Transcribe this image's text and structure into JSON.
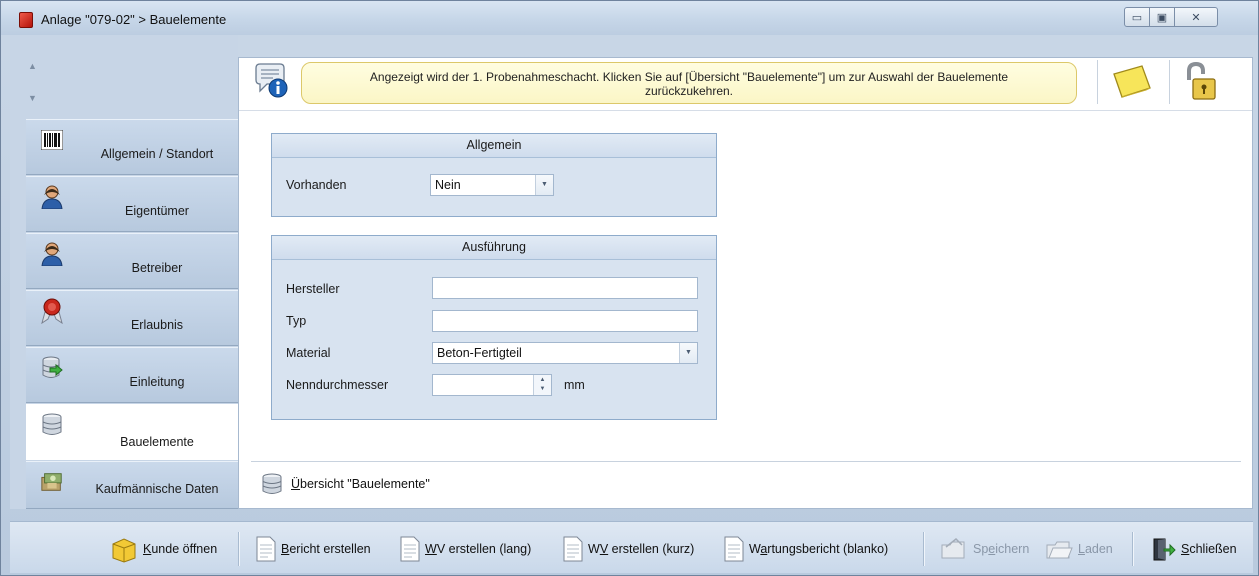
{
  "window": {
    "title": "Anlage \"079-02\" > Bauelemente",
    "controls": {
      "minimize": "▭",
      "maximize": "▣",
      "close": "✕"
    }
  },
  "nav": {
    "items": [
      {
        "label": "Allgemein / Standort",
        "icon": "barcode-icon",
        "active": false
      },
      {
        "label": "Eigentümer",
        "icon": "user-icon",
        "active": false
      },
      {
        "label": "Betreiber",
        "icon": "user-icon",
        "active": false
      },
      {
        "label": "Erlaubnis",
        "icon": "certificate-icon",
        "active": false
      },
      {
        "label": "Einleitung",
        "icon": "database-arrow-icon",
        "active": false
      },
      {
        "label": "Bauelemente",
        "icon": "database-icon",
        "active": true
      },
      {
        "label": "Kaufmännische Daten",
        "icon": "money-icon",
        "active": false
      }
    ]
  },
  "info": {
    "line1": "Angezeigt wird der 1. Probenahmeschacht. Klicken Sie auf [Übersicht \"Bauelemente\"] um zur Auswahl der Bauelemente",
    "line2": "zurückzukehren."
  },
  "groups": {
    "allgemein": {
      "title": "Allgemein",
      "vorhanden_label": "Vorhanden",
      "vorhanden_value": "Nein"
    },
    "ausfuehrung": {
      "title": "Ausführung",
      "hersteller_label": "Hersteller",
      "hersteller_value": "",
      "typ_label": "Typ",
      "typ_value": "",
      "material_label": "Material",
      "material_value": "Beton-Fertigteil",
      "nenndurchmesser_label": "Nenndurchmesser",
      "nenndurchmesser_value": "",
      "unit": "mm"
    }
  },
  "overview_link": {
    "underlined": "Ü",
    "rest": "bersicht \"Bauelemente\""
  },
  "toolbar": {
    "kunde_oeffnen": {
      "u": "K",
      "rest": "unde öffnen"
    },
    "bericht_erstellen": {
      "u": "B",
      "rest": "ericht erstellen"
    },
    "wv_lang": {
      "u": "W",
      "rest": "V erstellen (lang)"
    },
    "wv_kurz": {
      "pre": "W",
      "u": "V",
      "rest": " erstellen (kurz)"
    },
    "wartungsbericht": {
      "pre": "W",
      "u": "a",
      "rest": "rtungsbericht (blanko)"
    },
    "speichern": {
      "pre": "Sp",
      "u": "e",
      "rest": "ichern"
    },
    "laden": {
      "u": "L",
      "rest": "aden"
    },
    "schliessen": {
      "u": "S",
      "rest": "chließen"
    }
  },
  "colors": {
    "accent": "#c7d5e6",
    "info_bg": "#fbf6c6",
    "group_border": "#8eabcb",
    "brand_red": "#c8180d"
  }
}
